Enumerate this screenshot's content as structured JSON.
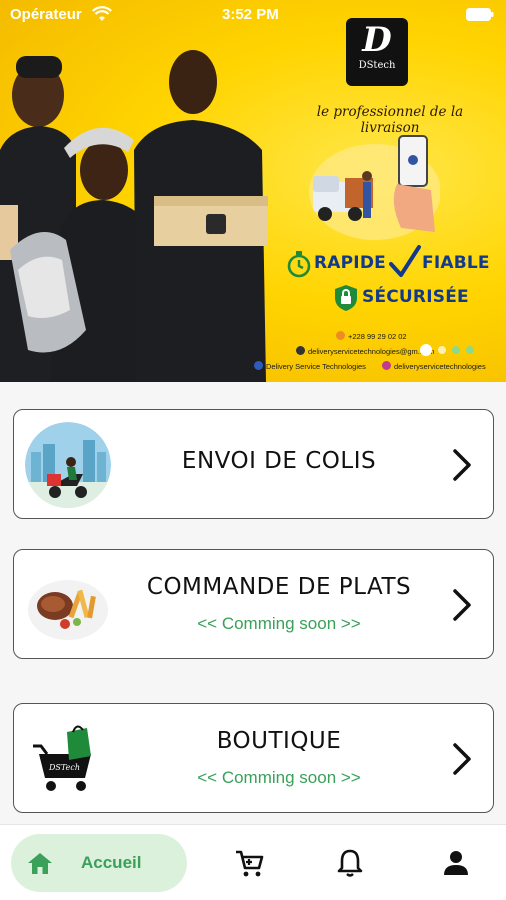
{
  "status_bar": {
    "carrier": "Opérateur",
    "time": "3:52 PM"
  },
  "banner": {
    "logo_text": "DStech",
    "tagline": "le professionnel de la livraison",
    "features": [
      "RAPIDE",
      "FIABLE",
      "SÉCURISÉE"
    ],
    "contact": {
      "phone": "+228 99 29 02 02",
      "email": "deliveryservicetechnologies@gm...om",
      "facebook": "Delivery Service Technologies",
      "instagram": "deliveryservicetechnologies"
    },
    "carousel": {
      "page_count": 4,
      "active_index": 1
    },
    "colors": {
      "background": "#ffd400",
      "feature_text": "#123a8c"
    }
  },
  "services": [
    {
      "title": "ENVOI DE COLIS",
      "subtitle": "",
      "thumb_icon": "scooter-delivery-icon"
    },
    {
      "title": "COMMANDE DE PLATS",
      "subtitle": "<< Comming soon >>",
      "thumb_icon": "food-plate-icon"
    },
    {
      "title": "BOUTIQUE",
      "subtitle": "<< Comming soon >>",
      "thumb_icon": "shopping-cart-bag-icon"
    }
  ],
  "bottom_nav": {
    "items": [
      {
        "label": "Accueil",
        "icon": "home-icon",
        "active": true
      },
      {
        "label": "",
        "icon": "cart-icon",
        "active": false
      },
      {
        "label": "",
        "icon": "bell-icon",
        "active": false
      },
      {
        "label": "",
        "icon": "person-icon",
        "active": false
      }
    ],
    "accent": "#3aa05a"
  }
}
